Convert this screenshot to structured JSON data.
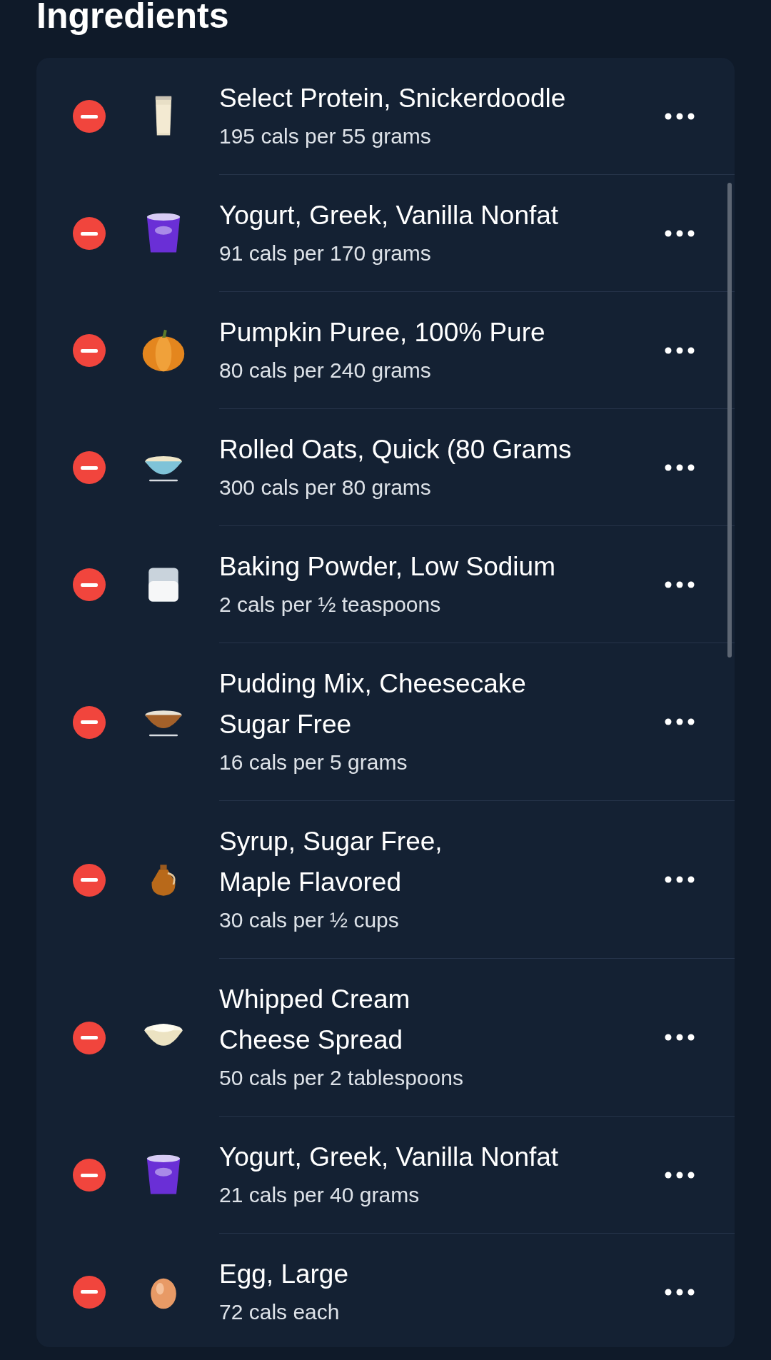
{
  "section_title": "Ingredients",
  "ingredients": [
    {
      "kind": "glass",
      "title": "Select Protein, Snickerdoodle",
      "detail": "195 cals per 55 grams"
    },
    {
      "kind": "cup",
      "title": "Yogurt, Greek, Vanilla Nonfat",
      "detail": "91 cals per 170 grams"
    },
    {
      "kind": "pumpkin",
      "title": "Pumpkin Puree, 100% Pure",
      "detail": "80 cals per 240 grams"
    },
    {
      "kind": "oat-bowl",
      "title": "Rolled Oats, Quick (80 Grams",
      "detail": "300 cals per 80 grams"
    },
    {
      "kind": "jar",
      "title": "Baking Powder, Low Sodium",
      "detail": "2 cals per ½ teaspoons"
    },
    {
      "kind": "pudding-bowl",
      "title": "Pudding Mix, Cheesecake\nSugar Free",
      "detail": "16 cals per 5 grams"
    },
    {
      "kind": "bottle",
      "title": "Syrup, Sugar Free,\nMaple Flavored",
      "detail": "30 cals per ½ cups"
    },
    {
      "kind": "cream-bowl",
      "title": "Whipped Cream\nCheese Spread",
      "detail": "50 cals per 2 tablespoons"
    },
    {
      "kind": "cup",
      "title": "Yogurt, Greek, Vanilla Nonfat",
      "detail": "21 cals per 40 grams"
    },
    {
      "kind": "egg",
      "title": "Egg, Large",
      "detail": "72 cals each"
    }
  ]
}
